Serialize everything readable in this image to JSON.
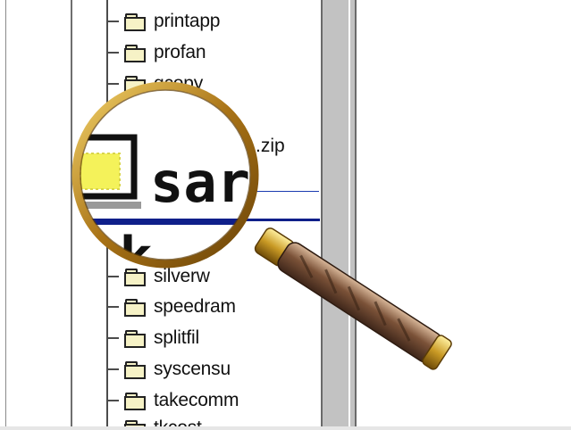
{
  "tree": {
    "items": [
      {
        "label": "printapp"
      },
      {
        "label": "profan"
      },
      {
        "label": "qcopy"
      },
      {
        "label": "silverw"
      },
      {
        "label": "speedram"
      },
      {
        "label": "splitfil"
      },
      {
        "label": "syscensu"
      },
      {
        "label": "takecomm"
      },
      {
        "label": "tkcost"
      }
    ],
    "zip_fragment": ".zip"
  },
  "magnifier": {
    "magnified_text": "sar",
    "magnified_text_2": "sk"
  },
  "icons": {
    "folder": "folder-icon",
    "magnifier": "magnifying-glass-icon"
  },
  "colors": {
    "selection": "#1a3bb0",
    "rim": "#b8860b"
  }
}
